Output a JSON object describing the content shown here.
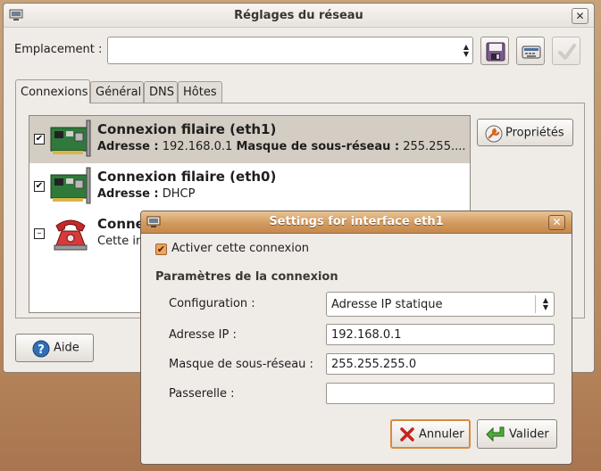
{
  "main_window": {
    "title": "Réglages du réseau",
    "location_label": "Emplacement :",
    "location_value": "",
    "tabs": [
      "Connexions",
      "Général",
      "DNS",
      "Hôtes"
    ],
    "connections": [
      {
        "checked": "✔",
        "name": "Connexion filaire (eth1)",
        "address_label": "Adresse :",
        "address_value": "192.168.0.1",
        "mask_label": "Masque de sous-réseau :",
        "mask_value": "255.255...."
      },
      {
        "checked": "✔",
        "name": "Connexion filaire (eth0)",
        "address_label": "Adresse :",
        "address_value": "DHCP"
      },
      {
        "checked": "–",
        "name": "Conne",
        "sub": "Cette in"
      }
    ],
    "properties_button": "Propriétés",
    "help_button": "Aide"
  },
  "dialog": {
    "title": "Settings for interface eth1",
    "enable_check": "✔",
    "enable_label": "Activer cette connexion",
    "section_title": "Paramètres de la connexion",
    "configuration_label": "Configuration :",
    "configuration_value": "Adresse IP statique",
    "ip_label": "Adresse IP :",
    "ip_value": "192.168.0.1",
    "mask_label": "Masque de sous-réseau :",
    "mask_value": "255.255.255.0",
    "gateway_label": "Passerelle :",
    "gateway_value": "",
    "cancel_button": "Annuler",
    "ok_button": "Valider"
  },
  "icons": {
    "window": "network-monitor-icon",
    "save": "floppy-save-icon",
    "delete": "keyboard-delete-icon",
    "apply": "checkmark-icon",
    "network_card": "network-card-icon",
    "modem": "telephone-modem-icon",
    "properties": "wrench-properties-icon",
    "help": "help-question-icon",
    "cancel": "red-x-icon",
    "validate": "green-arrow-icon"
  },
  "colors": {
    "dialog_title": "#d19a5f",
    "selected_row": "#d4cdc4",
    "help_blue": "#2f6fb7"
  }
}
